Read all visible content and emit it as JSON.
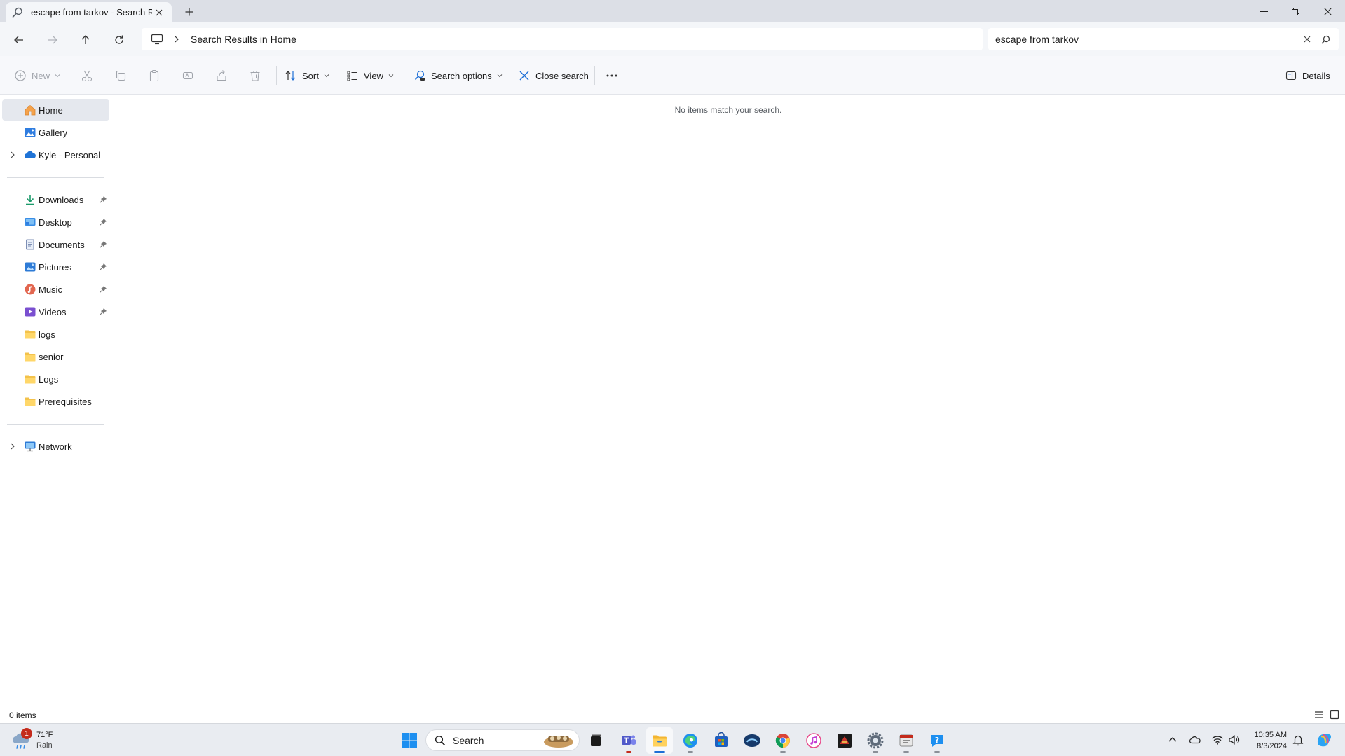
{
  "window": {
    "tab_title": "escape from tarkov - Search Re",
    "new_tab_label": "+"
  },
  "address": {
    "path": "Search Results in Home",
    "search_value": "escape from tarkov"
  },
  "commands": {
    "new": "New",
    "sort": "Sort",
    "view": "View",
    "search_options": "Search options",
    "close_search": "Close search",
    "more": "...",
    "details": "Details"
  },
  "sidebar": {
    "top": [
      {
        "label": "Home",
        "icon": "home-icon"
      },
      {
        "label": "Gallery",
        "icon": "gallery-icon"
      },
      {
        "label": "Kyle - Personal",
        "icon": "onedrive-icon"
      }
    ],
    "quick": [
      {
        "label": "Downloads",
        "icon": "download-icon"
      },
      {
        "label": "Desktop",
        "icon": "desktop-icon"
      },
      {
        "label": "Documents",
        "icon": "documents-icon"
      },
      {
        "label": "Pictures",
        "icon": "pictures-icon"
      },
      {
        "label": "Music",
        "icon": "music-icon"
      },
      {
        "label": "Videos",
        "icon": "videos-icon"
      },
      {
        "label": "logs",
        "icon": "folder-icon"
      },
      {
        "label": "senior",
        "icon": "folder-icon"
      },
      {
        "label": "Logs",
        "icon": "folder-icon"
      },
      {
        "label": "Prerequisites",
        "icon": "folder-icon"
      }
    ],
    "bottom": [
      {
        "label": "Network",
        "icon": "network-icon"
      }
    ]
  },
  "content": {
    "empty_message": "No items match your search."
  },
  "status": {
    "item_count": "0 items"
  },
  "taskbar": {
    "weather": {
      "temp": "71°F",
      "condition": "Rain",
      "badge": "1"
    },
    "search_label": "Search",
    "clock": {
      "time": "10:35 AM",
      "date": "8/3/2024"
    }
  },
  "colors": {
    "accent": "#1d6fd6",
    "folder": "#f3c24b",
    "badge": "#c42b1c"
  }
}
